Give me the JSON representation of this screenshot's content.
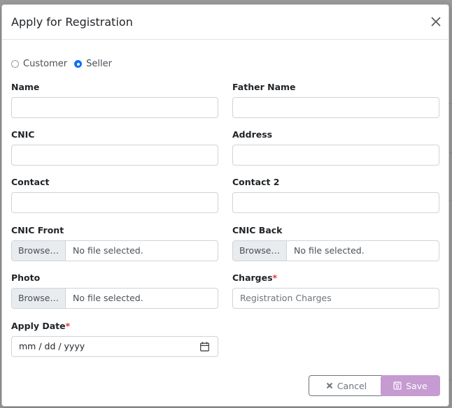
{
  "modal": {
    "title": "Apply for Registration",
    "close_icon": "close-icon"
  },
  "type_options": [
    {
      "label": "Customer",
      "checked": false
    },
    {
      "label": "Seller",
      "checked": true
    }
  ],
  "fields": {
    "name": {
      "label": "Name",
      "value": ""
    },
    "father_name": {
      "label": "Father Name",
      "value": ""
    },
    "cnic": {
      "label": "CNIC",
      "value": ""
    },
    "address": {
      "label": "Address",
      "value": ""
    },
    "contact": {
      "label": "Contact",
      "value": ""
    },
    "contact2": {
      "label": "Contact 2",
      "value": ""
    },
    "cnic_front": {
      "label": "CNIC Front",
      "browse": "Browse…",
      "status": "No file selected."
    },
    "cnic_back": {
      "label": "CNIC Back",
      "browse": "Browse…",
      "status": "No file selected."
    },
    "photo": {
      "label": "Photo",
      "browse": "Browse…",
      "status": "No file selected."
    },
    "charges": {
      "label": "Charges",
      "required_mark": "*",
      "placeholder": "Registration Charges"
    },
    "apply_date": {
      "label": "Apply Date",
      "required_mark": "*",
      "placeholder": "mm / dd / yyyy"
    }
  },
  "buttons": {
    "cancel": "Cancel",
    "save": "Save"
  },
  "colors": {
    "primary": "#0d6efd",
    "save_bg": "#c59bd1",
    "required": "#dc3545"
  }
}
